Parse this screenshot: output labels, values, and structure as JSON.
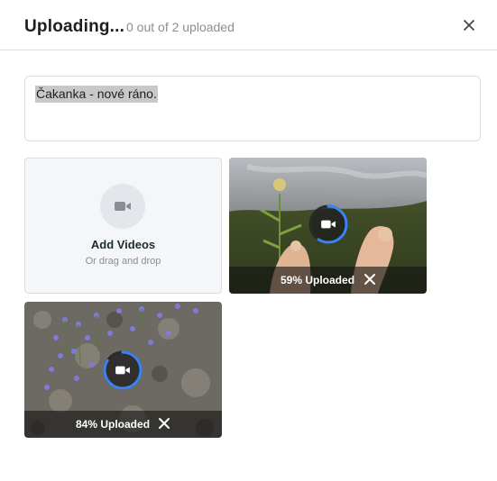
{
  "header": {
    "title": "Uploading...",
    "subtitle": "0 out of 2 uploaded",
    "close_icon": "close-icon"
  },
  "composer": {
    "text": "Čakanka - nové ráno."
  },
  "add_tile": {
    "label": "Add Videos",
    "hint": "Or drag and drop",
    "icon": "video-camera-icon"
  },
  "uploads": [
    {
      "progress_label": "59% Uploaded",
      "progress": 0.59,
      "icon": "video-camera-icon",
      "remove_icon": "close-icon"
    },
    {
      "progress_label": "84% Uploaded",
      "progress": 0.84,
      "icon": "video-camera-icon",
      "remove_icon": "close-icon"
    }
  ],
  "colors": {
    "accent": "#3b82f6",
    "ring_track": "#1a1a1a",
    "overlay": "#141414"
  }
}
